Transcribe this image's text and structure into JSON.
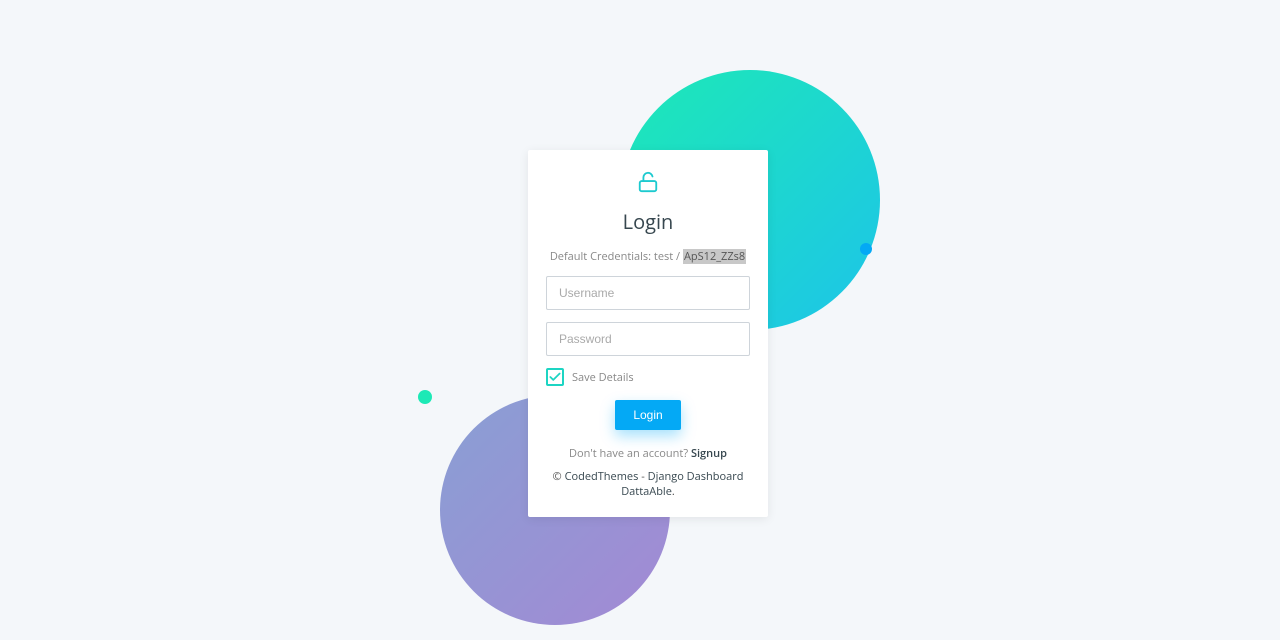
{
  "card": {
    "title": "Login",
    "credentials_prefix": "Default Credentials: test / ",
    "credentials_highlight": "ApS12_ZZs8",
    "username_placeholder": "Username",
    "password_placeholder": "Password",
    "save_label": "Save Details",
    "login_button": "Login",
    "signup_prefix": "Don't have an account? ",
    "signup_link": "Signup",
    "footer_prefix": "© ",
    "footer_link1": "CodedThemes",
    "footer_sep": " - ",
    "footer_link2": "Django Dashboard DattaAble",
    "footer_suffix": "."
  }
}
